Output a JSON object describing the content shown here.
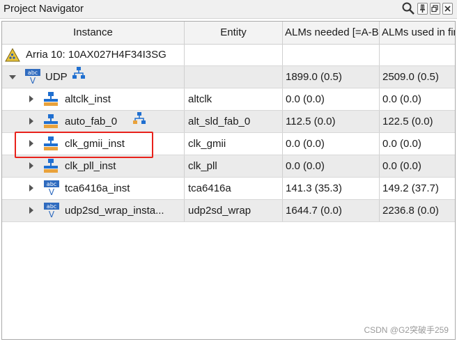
{
  "window": {
    "title": "Project Navigator",
    "icons": [
      "search-icon",
      "pin-icon",
      "restore-icon",
      "close-icon"
    ]
  },
  "table": {
    "headers": [
      "Instance",
      "Entity",
      "ALMs needed [=A-B+C]",
      "ALMs used in final placement"
    ],
    "device": "Arria 10: 10AX027H4F34I3SG",
    "top": {
      "label": "UDP",
      "n1": "1899.0 (0.5)",
      "n2": "2509.0 (0.5)"
    },
    "rows": [
      {
        "label": "altclk_inst",
        "entity": "altclk",
        "n1": "0.0 (0.0)",
        "n2": "0.0 (0.0)"
      },
      {
        "label": "auto_fab_0",
        "entity": "alt_sld_fab_0",
        "n1": "112.5 (0.0)",
        "n2": "122.5 (0.0)"
      },
      {
        "label": "clk_gmii_inst",
        "entity": "clk_gmii",
        "n1": "0.0 (0.0)",
        "n2": "0.0 (0.0)"
      },
      {
        "label": "clk_pll_inst",
        "entity": "clk_pll",
        "n1": "0.0 (0.0)",
        "n2": "0.0 (0.0)"
      },
      {
        "label": "tca6416a_inst",
        "entity": "tca6416a",
        "n1": "141.3 (35.3)",
        "n2": "149.2 (37.7)"
      },
      {
        "label": "udp2sd_wrap_insta...",
        "entity": "udp2sd_wrap",
        "n1": "1644.7 (0.0)",
        "n2": "2236.8 (0.0)"
      }
    ]
  },
  "watermark": "CSDN @G2突破手259",
  "colors": {
    "highlight": "#e8211b",
    "hier_blue": "#1f6fd0",
    "hier_orange": "#e9a23b"
  }
}
